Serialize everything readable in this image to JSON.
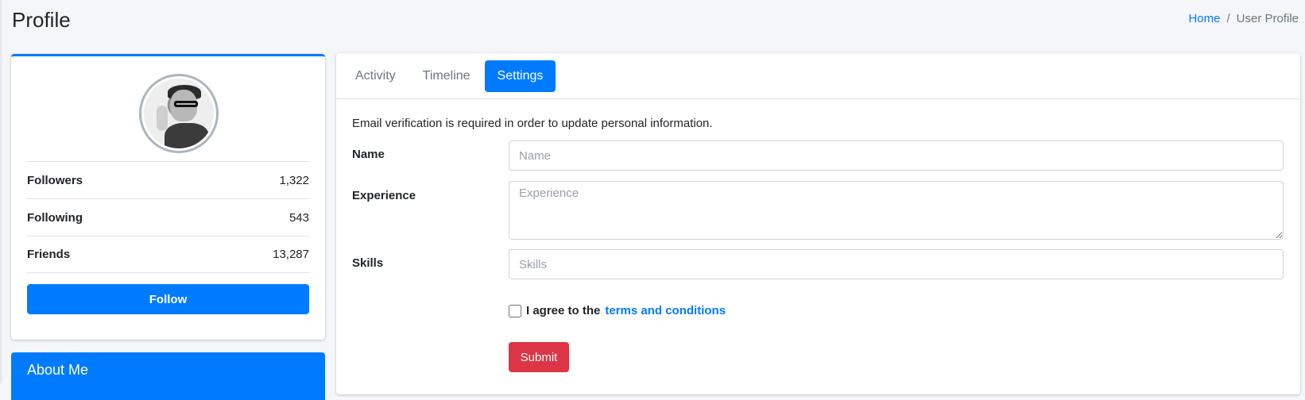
{
  "header": {
    "title": "Profile",
    "breadcrumb": {
      "home": "Home",
      "separator": "/",
      "current": "User Profile"
    }
  },
  "profile": {
    "stats": [
      {
        "label": "Followers",
        "value": "1,322"
      },
      {
        "label": "Following",
        "value": "543"
      },
      {
        "label": "Friends",
        "value": "13,287"
      }
    ],
    "follow_label": "Follow"
  },
  "about": {
    "title": "About Me"
  },
  "settings": {
    "tabs": [
      {
        "label": "Activity",
        "active": false
      },
      {
        "label": "Timeline",
        "active": false
      },
      {
        "label": "Settings",
        "active": true
      }
    ],
    "notice": "Email verification is required in order to update personal information.",
    "fields": {
      "name": {
        "label": "Name",
        "placeholder": "Name",
        "value": ""
      },
      "experience": {
        "label": "Experience",
        "placeholder": "Experience",
        "value": ""
      },
      "skills": {
        "label": "Skills",
        "placeholder": "Skills",
        "value": ""
      }
    },
    "terms": {
      "prefix": "I agree to the",
      "link": "terms and conditions",
      "checked": false
    },
    "submit_label": "Submit"
  },
  "colors": {
    "primary": "#007bff",
    "danger": "#dc3545",
    "background": "#f4f6f9"
  }
}
